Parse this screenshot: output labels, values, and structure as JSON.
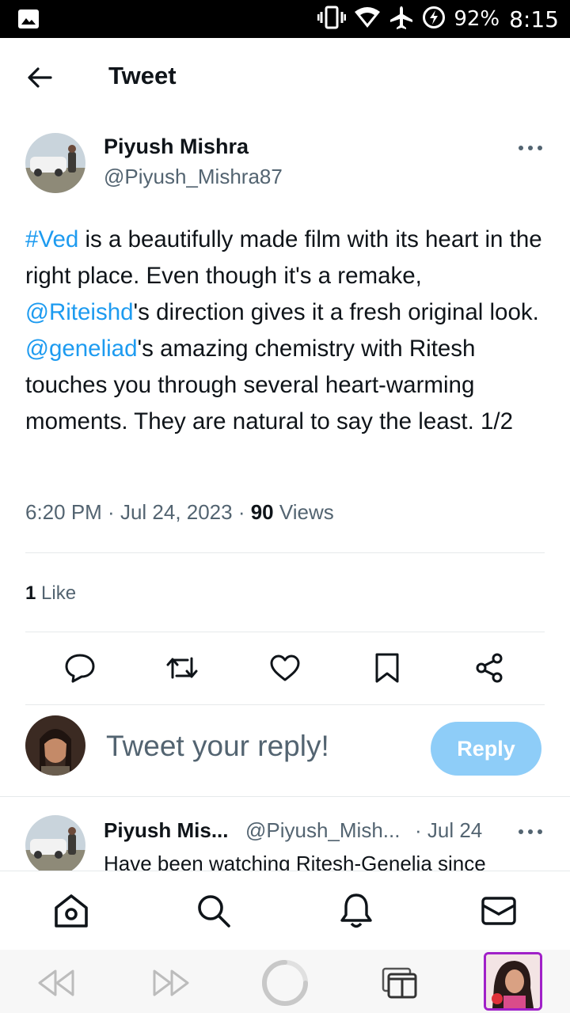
{
  "status_bar": {
    "battery": "92%",
    "time": "8:15",
    "icons": [
      "image-icon",
      "vibrate-icon",
      "wifi-icon",
      "airplane-icon",
      "battery-charging-icon"
    ]
  },
  "header": {
    "title": "Tweet",
    "back_icon": "arrow-left-icon"
  },
  "tweet": {
    "author_name": "Piyush Mishra",
    "author_handle": "@Piyush_Mishra87",
    "text_parts": {
      "p1": "#Ved",
      "p2": " is a beautifully made film with its heart in the right place. Even though it's a remake, ",
      "p3": "@Riteishd",
      "p4": "'s direction gives it a fresh original look. ",
      "p5": "@geneliad",
      "p6": "'s amazing chemistry with Ritesh touches you through several heart-warming moments. They are natural to say the least. 1/2"
    },
    "time": "6:20 PM",
    "date": "Jul 24, 2023",
    "views_count": "90",
    "views_label": "Views",
    "likes_count": "1",
    "likes_label": "Like"
  },
  "actions": [
    "reply-icon",
    "retweet-icon",
    "like-icon",
    "bookmark-icon",
    "share-icon"
  ],
  "composer": {
    "placeholder": "Tweet your reply!",
    "button_label": "Reply"
  },
  "reply_tweet": {
    "author_name": "Piyush Mis...",
    "author_handle": "@Piyush_Mish...",
    "date": "· Jul 24",
    "text": "Have been watching Ritesh-Genelia since"
  },
  "bottom_nav": [
    "home-icon",
    "search-icon",
    "notifications-icon",
    "messages-icon"
  ],
  "browser_bar": [
    "back-icon",
    "forward-icon",
    "reload-icon",
    "tabs-icon",
    "profile-thumbnail"
  ],
  "colors": {
    "link": "#1d9bf0",
    "reply_button": "#8ecdf8",
    "muted": "#536471"
  }
}
